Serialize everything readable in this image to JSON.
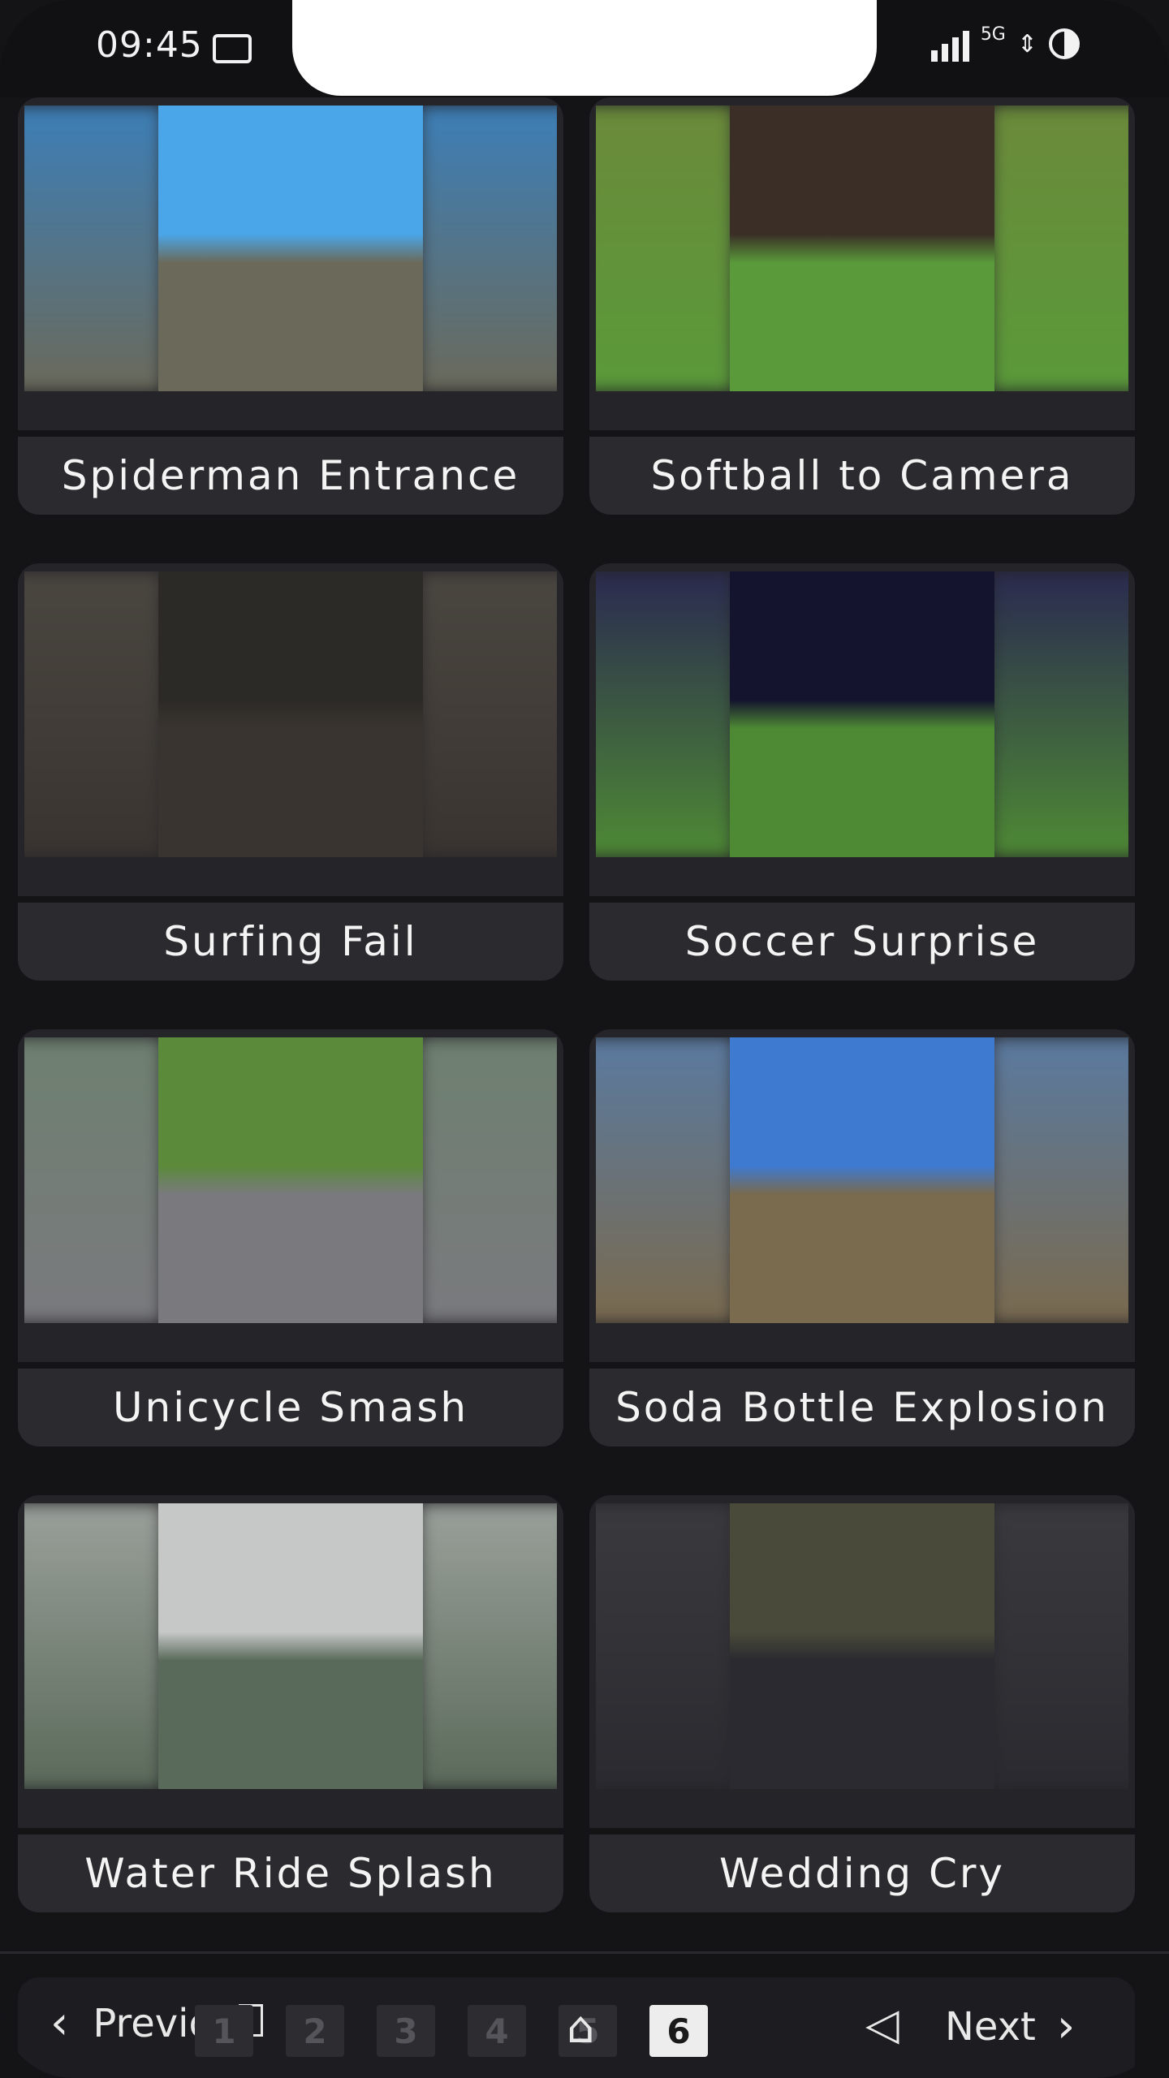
{
  "status_bar": {
    "time": "09:45",
    "network": "5G"
  },
  "videos": [
    {
      "title": "Spiderman Entrance",
      "scene": {
        "sky": "#4aa6e8",
        "ground": "#6b6a5a",
        "side": "#3c7fb8"
      }
    },
    {
      "title": "Softball to Camera",
      "scene": {
        "sky": "#3a2e26",
        "ground": "#5a9a3a",
        "side": "#6b8a3a"
      }
    },
    {
      "title": "Surfing Fail",
      "scene": {
        "sky": "#2c2a26",
        "ground": "#3a3430",
        "side": "#4a4640"
      }
    },
    {
      "title": "Soccer Surprise",
      "scene": {
        "sky": "#14142e",
        "ground": "#4e8a34",
        "side": "#2a2a50"
      }
    },
    {
      "title": "Unicycle Smash",
      "scene": {
        "sky": "#5a8a3a",
        "ground": "#7a7a7e",
        "side": "#6e8070"
      }
    },
    {
      "title": "Soda Bottle Explosion",
      "scene": {
        "sky": "#3e7ad0",
        "ground": "#7a6a4e",
        "side": "#5a7aa0"
      }
    },
    {
      "title": "Water Ride Splash",
      "scene": {
        "sky": "#c6c8c8",
        "ground": "#5a6a5a",
        "side": "#9aa09a"
      }
    },
    {
      "title": "Wedding Cry",
      "scene": {
        "sky": "#4a4a3a",
        "ground": "#2a2a30",
        "side": "#3a3a3e"
      }
    }
  ],
  "pagination": {
    "prev_label": "Previou",
    "next_label": "Next",
    "pages": [
      "1",
      "2",
      "3",
      "4",
      "5",
      "6"
    ],
    "current_page": "6"
  }
}
